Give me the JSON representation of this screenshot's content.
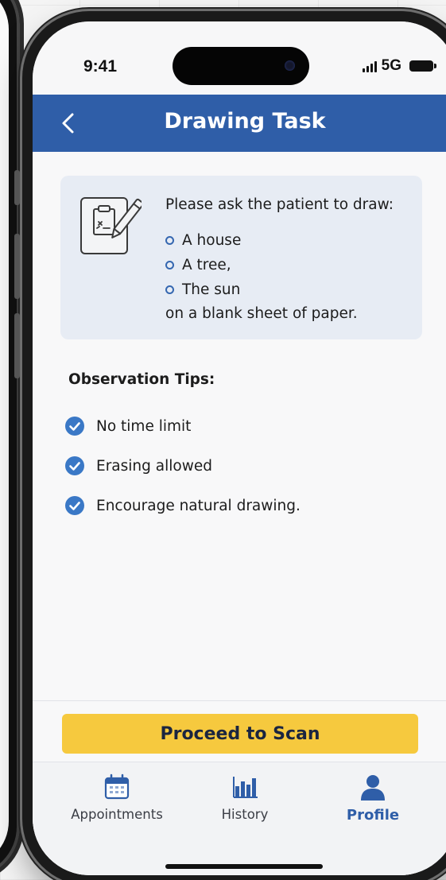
{
  "status_bar": {
    "time": "9:41",
    "network": "5G"
  },
  "header": {
    "title": "Drawing Task",
    "back_icon": "chevron-left-icon"
  },
  "instructions": {
    "icon": "clipboard-pencil-icon",
    "prompt": "Please ask the patient to draw:",
    "items": [
      "A house",
      "A tree,",
      "The sun"
    ],
    "suffix": "on a blank sheet of paper."
  },
  "tips": {
    "heading": "Observation Tips:",
    "items": [
      "No time limit",
      "Erasing allowed",
      "Encourage natural drawing."
    ]
  },
  "primary_button": {
    "label": "Proceed to Scan"
  },
  "tab_bar": {
    "tabs": [
      {
        "label": "Appointments",
        "icon": "calendar-icon",
        "active": false
      },
      {
        "label": "History",
        "icon": "bar-chart-icon",
        "active": false
      },
      {
        "label": "Profile",
        "icon": "person-icon",
        "active": true
      }
    ]
  },
  "colors": {
    "accent": "#2f5ea8",
    "button": "#f6c93e",
    "card_background": "#e7ecf4",
    "check": "#3a78c6"
  }
}
